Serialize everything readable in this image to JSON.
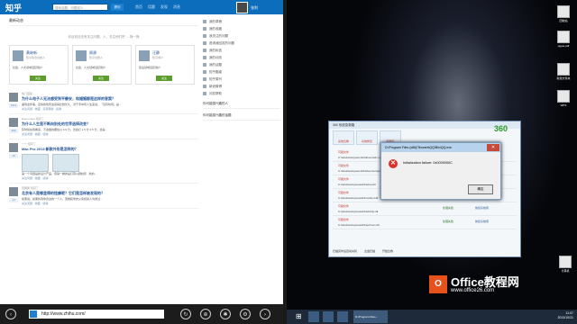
{
  "zhihu": {
    "logo": "知乎",
    "search_placeholder": "搜索话题、问题或人",
    "ask": "提问",
    "nav": [
      "首页",
      "话题",
      "发现",
      "消息"
    ],
    "user": "张利",
    "feed_header": "最新动态",
    "empty_tip": "你目前还没有关注问题、人，关注他们吧 →  换一换",
    "cards": [
      {
        "name": "黄继新",
        "desc": "知乎联合创始人",
        "reason": "社会、人文领域活跃用户",
        "follow": "关注"
      },
      {
        "name": "周源",
        "desc": "知乎创始人",
        "reason": "社会、人文领域活跃用户",
        "follow": "关注"
      },
      {
        "name": "汪静",
        "desc": "知乎用户",
        "reason": "建设领域活跃用户",
        "follow": "关注"
      }
    ],
    "feeds": [
      {
        "meta": "热门回答",
        "q": "为什么电子人无法感受到平静安，和婚姻都是这样的答案？",
        "a": "遇到这件事，爱情的欢庆会来得比较长久，对于手中有人生来说，「没有时间」是...",
        "b": "关注问题 · 收藏 · 没有帮助 · 感谢",
        "vote": "1512"
      },
      {
        "meta": "Eason Guo 赞同了",
        "q": "为什么人生是不断向别处的世界选择改变？",
        "a": "有时候在我看来，不会做的要给以 4.9 分，也会打 1.5 分 2.5 分，这是...",
        "b": "关注问题 · 收藏 · 感谢",
        "vote": "386"
      },
      {
        "meta": "一一 赞同了",
        "q": "Mac Pro 2013 新款外形是怎样的？",
        "a": "第一个问题是新设计产品，值得一看的是打算以圆柱形 · 新的...",
        "b": "关注问题 · 收藏 · 感谢",
        "vote": "16"
      },
      {
        "meta": "周鹏鹏 赞同了",
        "q": "北京有人是哪里得的怪癖呢？它们是怎样被发现的？",
        "a": "如果说，如果找到你身边的一个人，离婚和你的父亲和别人沟通过...",
        "b": "关注问题 · 收藏 · 感谢",
        "vote": "14"
      }
    ],
    "side": [
      "我的草稿",
      "我的收藏",
      "我关注的问题",
      "邀请我回答的问题",
      "我的私信",
      "我的动态",
      "我的话题",
      "知乎圆桌",
      "知乎周刊",
      "新浪微博",
      "问答帮助"
    ],
    "side_label_1": "你可能感兴趣的人",
    "side_label_2": "你可能感兴趣的话题",
    "url": "http://www.zhihu.com/"
  },
  "window360": {
    "title": "360 系统急救箱",
    "logo": "360",
    "tabs": [
      "系统急救",
      "系统修复",
      "隔离区"
    ],
    "rows": [
      {
        "title": "可疑文件",
        "path": "C:\\windows\\system32\\drivers\\tdx.sys",
        "status": "处理失败",
        "action": "恢复系统项"
      },
      {
        "title": "可疑文件",
        "path": "C:\\windows\\system32\\wbem\\wmiprvse.exe",
        "status": "处理失败",
        "action": "恢复系统项"
      },
      {
        "title": "可疑文件",
        "path": "C:\\windows\\syswow64\\winst.dll",
        "status": "处理失败",
        "action": "恢复系统项"
      },
      {
        "title": "可疑文件",
        "path": "C:\\windows\\syswow64\\mshtml.dll",
        "status": "处理失败",
        "action": "恢复系统项"
      },
      {
        "title": "可疑文件",
        "path": "C:\\windows\\syswow64\\winhttp.dll",
        "status": "处理失败",
        "action": "恢复系统项"
      },
      {
        "title": "可疑文件",
        "path": "C:\\windows\\syswow64\\perfmon.dll",
        "status": "处理失败",
        "action": "恢复系统项"
      }
    ],
    "foot": [
      "扫描完毕后自动关机",
      "全盘扫描",
      "开始急救"
    ]
  },
  "error": {
    "title": "D:\\Program Files (x86)\\Tencent\\QQ\\Bin\\QQ.exe",
    "message": "Initialization failure: 0x0000000C",
    "ok": "确定",
    "icon": "error-icon"
  },
  "desktop_icons": [
    {
      "label": "回收站"
    },
    {
      "label": "qqpet.pdf"
    },
    {
      "label": "新建文件夹"
    },
    {
      "label": "WPS"
    },
    {
      "label": "计算机"
    }
  ],
  "watermark": {
    "glyph": "O",
    "line1": "Office教程网",
    "line2": "www.office26.com"
  },
  "taskbar": {
    "app": "D:\\Program Files...",
    "time": "11:07",
    "date": "2013/10/21"
  }
}
